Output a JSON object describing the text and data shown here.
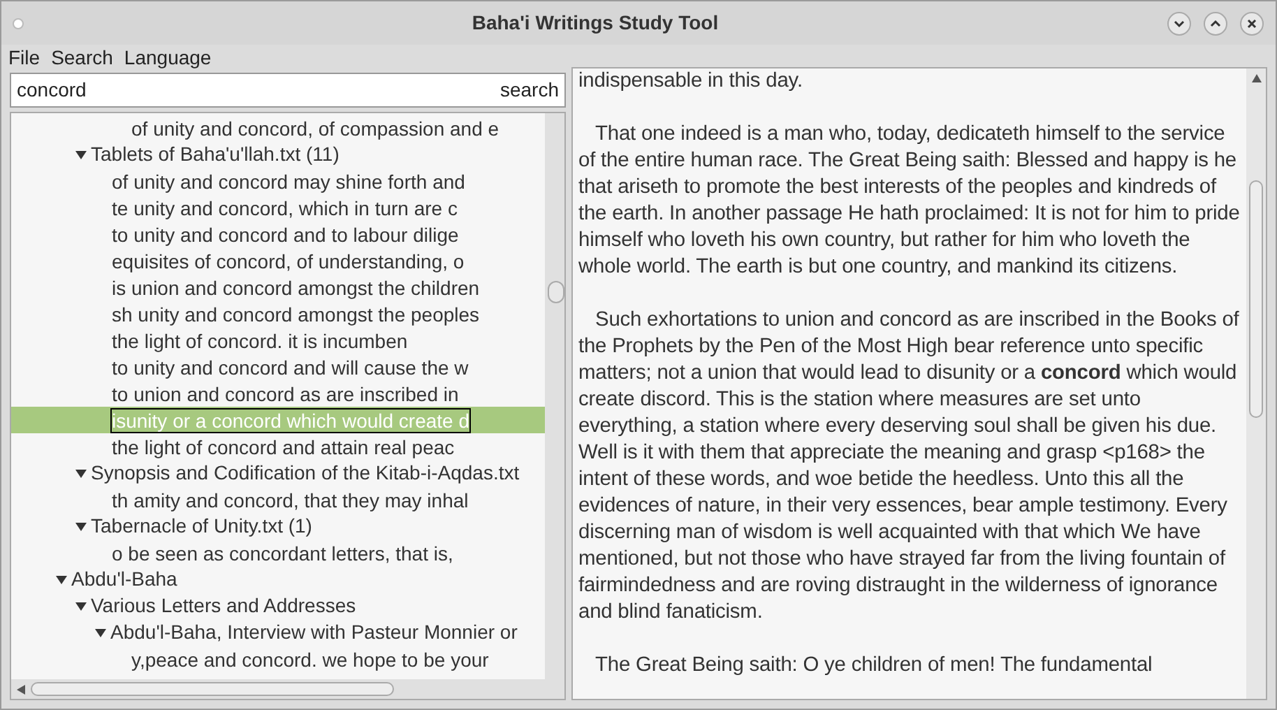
{
  "window": {
    "title": "Baha'i Writings Study Tool"
  },
  "menu": [
    "File",
    "Search",
    "Language"
  ],
  "search": {
    "value": "concord",
    "button": "search"
  },
  "tree": [
    {
      "children": [
        {
          "children": [
            {
              "children": [
                {
                  "label": "of unity and concord, of compassion and e",
                  "selected": false
                }
              ]
            }
          ]
        },
        {
          "label": "Tablets of Baha'u'llah.txt (11)",
          "expanded": true,
          "children": [
            {
              "label": "of unity and concord may shine forth and",
              "selected": false
            },
            {
              "label": "te unity and concord, which in turn are c",
              "selected": false
            },
            {
              "label": "to unity and concord and to labour dilige",
              "selected": false
            },
            {
              "label": "equisites of concord, of understanding, o",
              "selected": false
            },
            {
              "label": "is union and concord amongst the children",
              "selected": false
            },
            {
              "label": "sh unity and concord amongst the peoples",
              "selected": false
            },
            {
              "label": "the light of concord. it is incumben",
              "selected": false
            },
            {
              "label": "to unity and concord and will cause the w",
              "selected": false
            },
            {
              "label": "to union and concord as are inscribed in",
              "selected": false
            },
            {
              "label": "isunity or a concord which would create d",
              "selected": true
            },
            {
              "label": "the light of concord and attain real peac",
              "selected": false
            }
          ]
        },
        {
          "label": "Synopsis and Codification of the Kitab-i-Aqdas.txt",
          "expanded": true,
          "children": [
            {
              "label": "th amity and concord, that they may inhal",
              "selected": false
            }
          ]
        },
        {
          "label": "Tabernacle of Unity.txt (1)",
          "expanded": true,
          "children": [
            {
              "label": "o be seen as concordant letters, that is,",
              "selected": false
            }
          ]
        }
      ]
    },
    {
      "label": "Abdu'l-Baha",
      "expanded": true,
      "children": [
        {
          "label": "Various Letters and Addresses",
          "expanded": true,
          "children": [
            {
              "label": "Abdu'l-Baha, Interview with Pasteur Monnier or",
              "expanded": true,
              "children": [
                {
                  "label": "y,peace and concord. we hope to be your",
                  "selected": false
                }
              ]
            }
          ]
        }
      ]
    }
  ],
  "document": {
    "paragraphs": [
      {
        "text": "indispensable in this day.",
        "indent": false
      },
      {
        "text": "That one indeed is a man who, today, dedicateth himself to the service of the entire human race. The Great Being saith: Blessed and happy is he that ariseth to promote the best interests of the peoples and kindreds of the earth. In another passage He hath proclaimed: It is not for him to pride himself who loveth his own country, but rather for him who loveth the whole world. The earth is but one country, and mankind its citizens.",
        "indent": true
      },
      {
        "text": "Such exhortations to union and concord as are inscribed in the Books of the Prophets by the Pen of the Most High bear reference unto specific matters; not a union that would lead to disunity or a **concord** which would create discord. This is the station where measures are set unto everything, a station where every deserving soul shall be given his due. Well is it with them that appreciate the meaning and grasp <p168> the intent of these words, and woe betide the heedless. Unto this all the evidences of nature, in their very essences, bear ample testimony. Every discerning man of wisdom is well acquainted with that which We have mentioned, but not those who have strayed far from the living fountain of fairmindedness and are roving distraught in the wilderness of ignorance and blind fanaticism.",
        "indent": true
      },
      {
        "text": "The Great Being saith: O ye children of men! The fundamental",
        "indent": true
      }
    ]
  }
}
